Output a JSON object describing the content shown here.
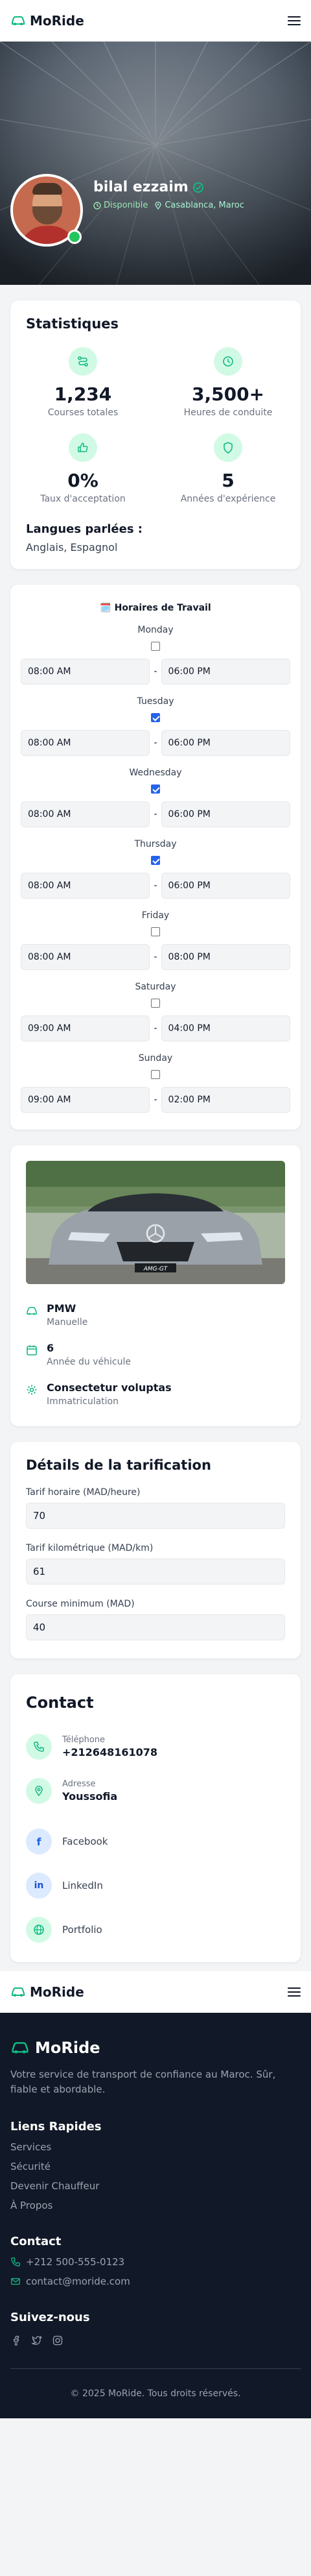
{
  "header": {
    "brand": "MoRide"
  },
  "profile": {
    "name": "bilal ezzaim",
    "status": "Disponible",
    "location": "Casablanca, Maroc"
  },
  "stats": {
    "title": "Statistiques",
    "items": [
      {
        "value": "1,234",
        "label": "Courses totales",
        "icon": "route-icon"
      },
      {
        "value": "3,500+",
        "label": "Heures de conduite",
        "icon": "clock-icon"
      },
      {
        "value": "0%",
        "label": "Taux d'acceptation",
        "icon": "thumbs-up-icon"
      },
      {
        "value": "5",
        "label": "Années d'expérience",
        "icon": "shield-icon"
      }
    ],
    "languages_title": "Langues parlées :",
    "languages": "Anglais, Espagnol"
  },
  "schedule": {
    "title": "🗓️ Horaires de Travail",
    "days": [
      {
        "name": "Monday",
        "checked": false,
        "start": "08:00 AM",
        "end": "06:00 PM"
      },
      {
        "name": "Tuesday",
        "checked": true,
        "start": "08:00 AM",
        "end": "06:00 PM"
      },
      {
        "name": "Wednesday",
        "checked": true,
        "start": "08:00 AM",
        "end": "06:00 PM"
      },
      {
        "name": "Thursday",
        "checked": true,
        "start": "08:00 AM",
        "end": "06:00 PM"
      },
      {
        "name": "Friday",
        "checked": false,
        "start": "08:00 AM",
        "end": "08:00 PM"
      },
      {
        "name": "Saturday",
        "checked": false,
        "start": "09:00 AM",
        "end": "04:00 PM"
      },
      {
        "name": "Sunday",
        "checked": false,
        "start": "09:00 AM",
        "end": "02:00 PM"
      }
    ]
  },
  "vehicle": {
    "plate_text": "AMG-GT",
    "items": [
      {
        "main": "PMW",
        "sub": "Manuelle",
        "icon": "car-icon"
      },
      {
        "main": "6",
        "sub": "Année du véhicule",
        "icon": "calendar-icon"
      },
      {
        "main": "Consectetur voluptas",
        "sub": "Immatriculation",
        "icon": "gear-icon"
      }
    ]
  },
  "pricing": {
    "title": "Détails de la tarification",
    "fields": [
      {
        "label": "Tarif horaire (MAD/heure)",
        "value": "70"
      },
      {
        "label": "Tarif kilométrique (MAD/km)",
        "value": "61"
      },
      {
        "label": "Course minimum (MAD)",
        "value": "40"
      }
    ]
  },
  "contact": {
    "title": "Contact",
    "phone_label": "Téléphone",
    "phone": "+212648161078",
    "address_label": "Adresse",
    "address": "Youssofia",
    "socials": [
      "Facebook",
      "LinkedIn",
      "Portfolio"
    ]
  },
  "footer": {
    "brand": "MoRide",
    "tagline": "Votre service de transport de confiance au Maroc. Sûr, fiable et abordable.",
    "links_title": "Liens Rapides",
    "links": [
      "Services",
      "Sécurité",
      "Devenir Chauffeur",
      "À Propos"
    ],
    "contact_title": "Contact",
    "phone": "+212 500-555-0123",
    "email": "contact@moride.com",
    "follow_title": "Suivez-nous",
    "copyright": "© 2025 MoRide. Tous droits réservés."
  },
  "colors": {
    "accent": "#10b981",
    "footer_bg": "#111827"
  }
}
